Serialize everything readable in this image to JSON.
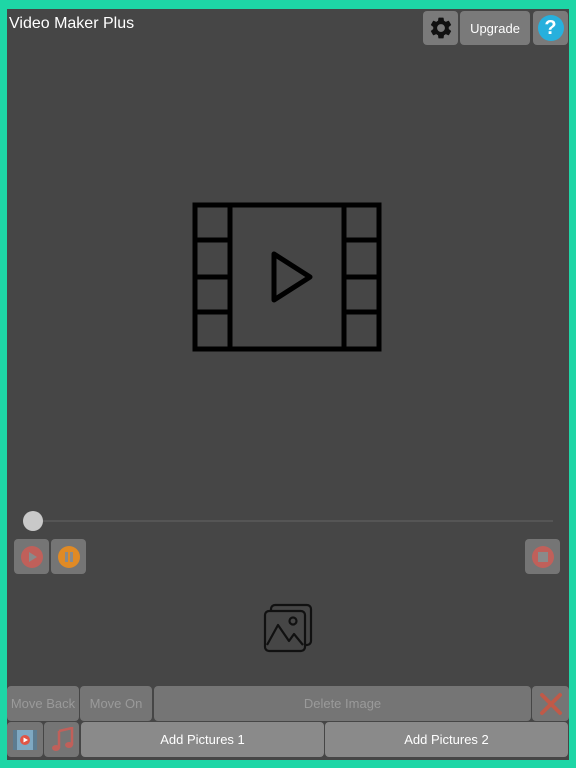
{
  "app": {
    "title": "Video Maker Plus"
  },
  "toolbar": {
    "settings_icon": "gear-icon",
    "upgrade_label": "Upgrade",
    "help_label": "?"
  },
  "preview": {
    "icon": "film-play-icon"
  },
  "player": {
    "progress": 0.0
  },
  "actions": {
    "move_back_label": "Move Back",
    "move_on_label": "Move On",
    "delete_label": "Delete Image",
    "add_pictures_1_label": "Add Pictures 1",
    "add_pictures_2_label": "Add Pictures 2"
  },
  "colors": {
    "frame": "#1ed6a6",
    "background": "#464646",
    "button": "#7a7a7a",
    "help": "#27b0dd",
    "play": "#c0605a",
    "pause": "#e08a25",
    "stop": "#c0605a",
    "close": "#c05a48"
  }
}
